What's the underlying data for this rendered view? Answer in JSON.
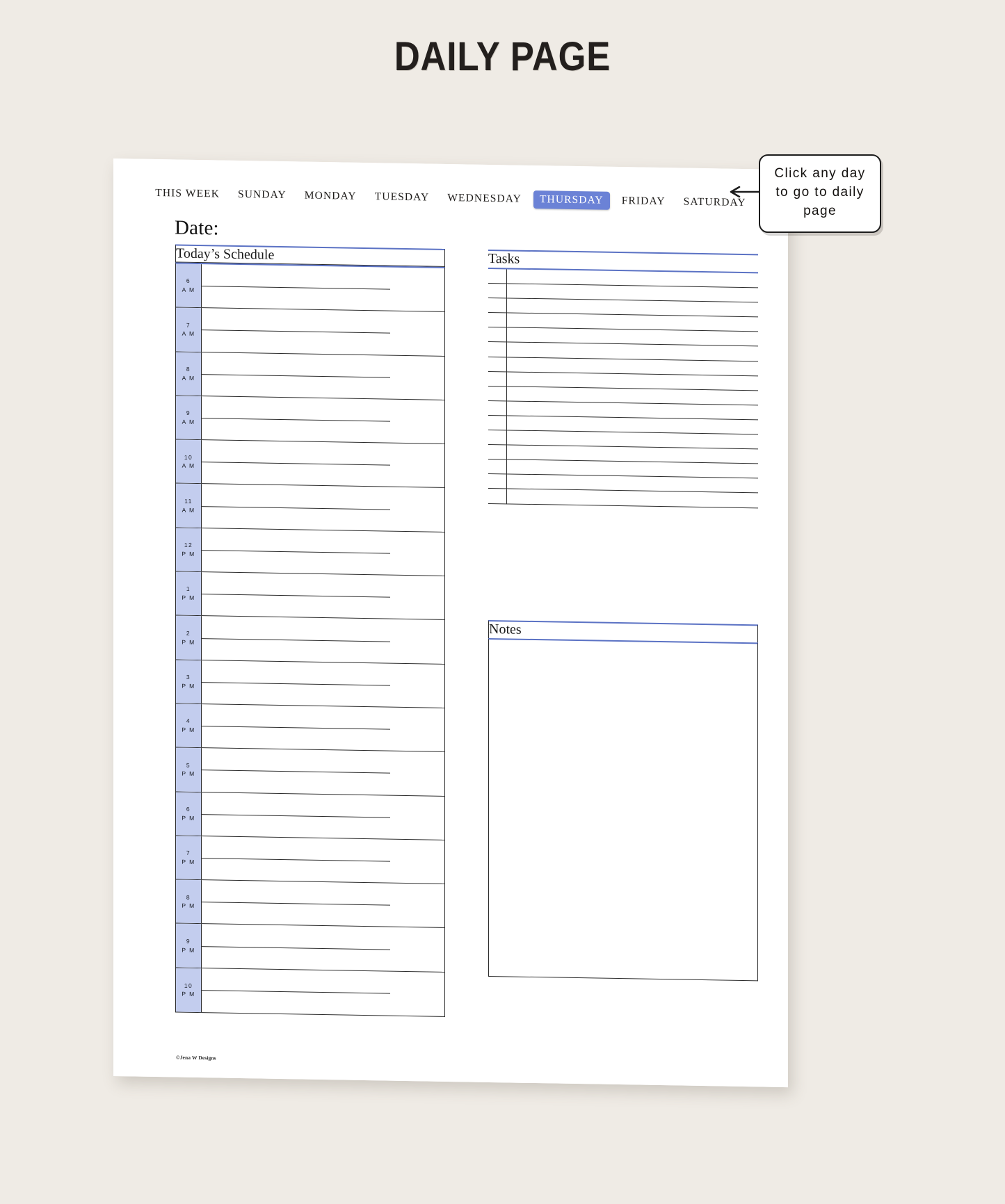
{
  "title": "DAILY PAGE",
  "nav": {
    "items": [
      {
        "label": "THIS WEEK",
        "active": false
      },
      {
        "label": "SUNDAY",
        "active": false
      },
      {
        "label": "MONDAY",
        "active": false
      },
      {
        "label": "TUESDAY",
        "active": false
      },
      {
        "label": "WEDNESDAY",
        "active": false
      },
      {
        "label": "THURSDAY",
        "active": true
      },
      {
        "label": "FRIDAY",
        "active": false
      },
      {
        "label": "SATURDAY",
        "active": false
      }
    ],
    "active_label": "THURSDAY",
    "active_bg": "#6b82d6"
  },
  "date_label": "Date:",
  "sections": {
    "schedule_heading": "Today’s Schedule",
    "tasks_heading": "Tasks",
    "notes_heading": "Notes"
  },
  "schedule": {
    "accent_color": "#5b72c4",
    "block_color": "#c3cdee",
    "hours": [
      {
        "num": "6",
        "period": "A M"
      },
      {
        "num": "7",
        "period": "A M"
      },
      {
        "num": "8",
        "period": "A M"
      },
      {
        "num": "9",
        "period": "A M"
      },
      {
        "num": "10",
        "period": "A M"
      },
      {
        "num": "11",
        "period": "A M"
      },
      {
        "num": "12",
        "period": "P M"
      },
      {
        "num": "1",
        "period": "P M"
      },
      {
        "num": "2",
        "period": "P M"
      },
      {
        "num": "3",
        "period": "P M"
      },
      {
        "num": "4",
        "period": "P M"
      },
      {
        "num": "5",
        "period": "P M"
      },
      {
        "num": "6",
        "period": "P M"
      },
      {
        "num": "7",
        "period": "P M"
      },
      {
        "num": "8",
        "period": "P M"
      },
      {
        "num": "9",
        "period": "P M"
      },
      {
        "num": "10",
        "period": "P M"
      }
    ]
  },
  "tasks": {
    "line_count": 16,
    "values": [
      "",
      "",
      "",
      "",
      "",
      "",
      "",
      "",
      "",
      "",
      "",
      "",
      "",
      "",
      "",
      ""
    ]
  },
  "notes": {
    "value": ""
  },
  "callout": {
    "text": "Click any day to go to daily page"
  },
  "footer": {
    "credit": "©Jena W Designs"
  },
  "colors": {
    "page_background": "#efebe5",
    "paper": "#ffffff",
    "ink": "#1d1b19",
    "accent_blue": "#5b72c4",
    "highlight_blue": "#6b82d6",
    "block_blue": "#c3cdee"
  }
}
